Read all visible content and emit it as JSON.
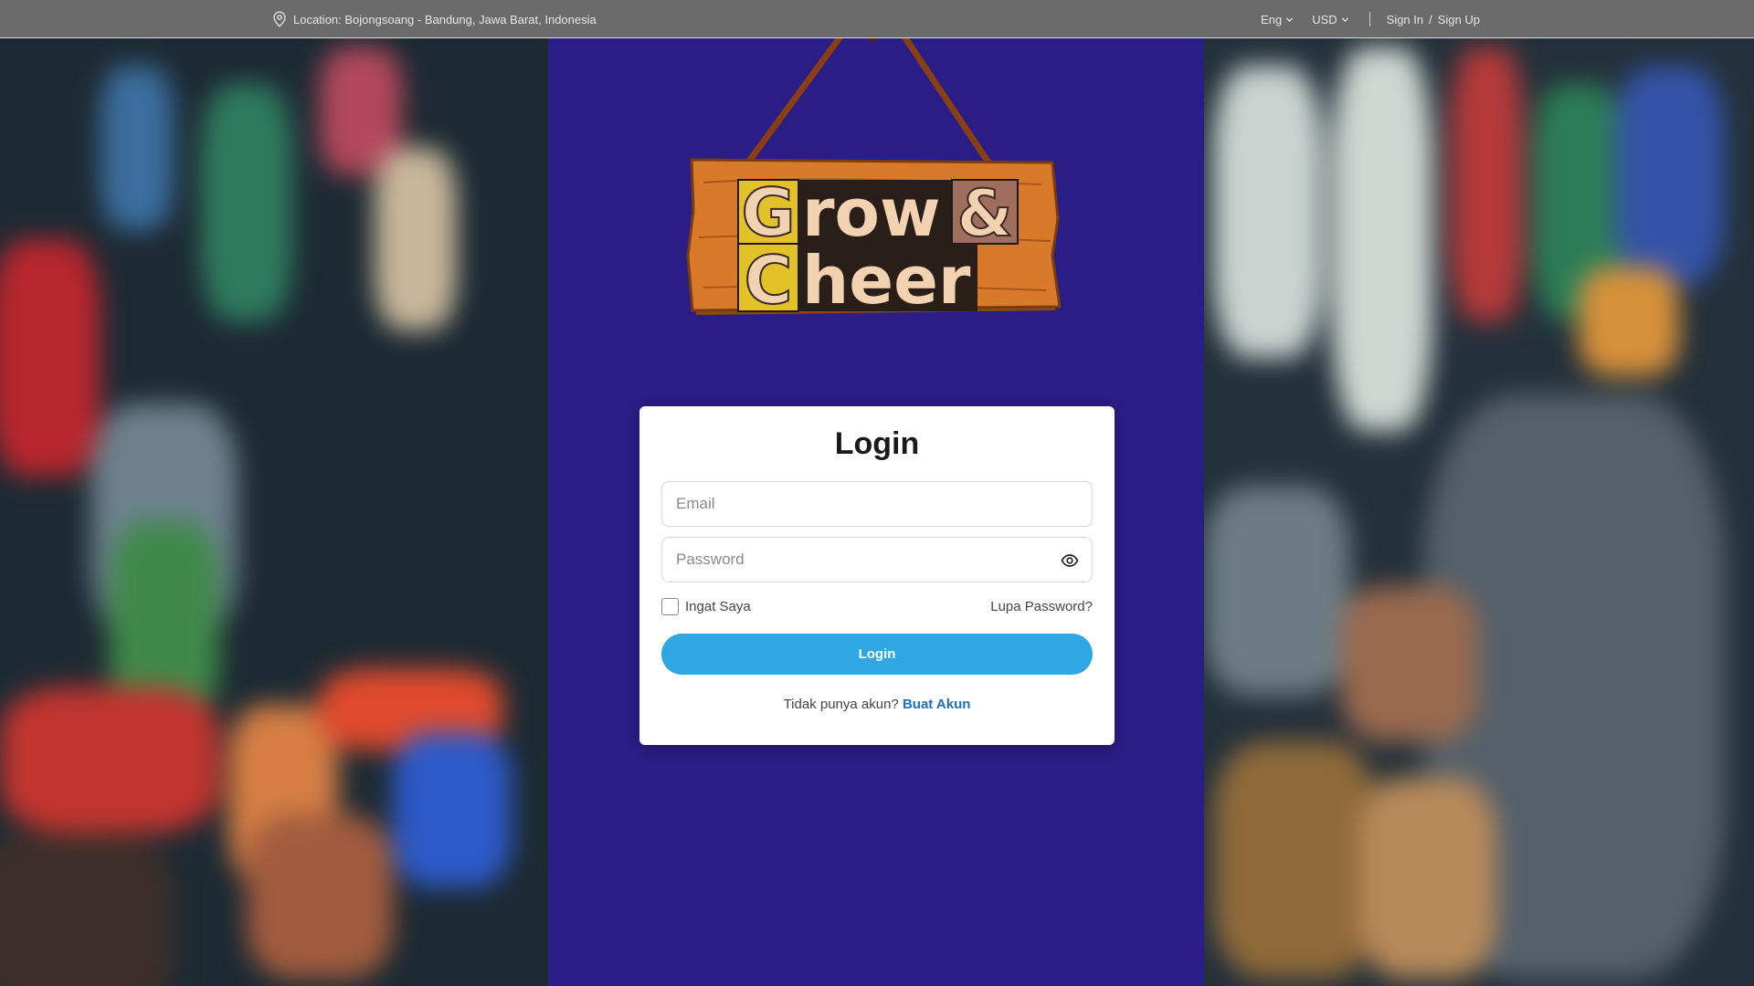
{
  "topbar": {
    "location_icon": "map-pin-icon",
    "location_text": "Location: Bojongsoang - Bandung, Jawa Barat, Indonesia",
    "language": "Eng",
    "currency": "USD",
    "sign_in": "Sign In",
    "separator": "/",
    "sign_up": "Sign Up"
  },
  "logo": {
    "line1_first": "G",
    "line1_rest": "row",
    "ampersand": "&",
    "line2_first": "C",
    "line2_rest": "heer"
  },
  "login": {
    "title": "Login",
    "email_placeholder": "Email",
    "password_placeholder": "Password",
    "remember_label": "Ingat Saya",
    "forgot_label": "Lupa Password?",
    "button_label": "Login",
    "no_account_text": "Tidak punya akun?",
    "create_account_link": "Buat Akun"
  },
  "colors": {
    "topbar_bg": "#6b6b6b",
    "center_bg": "#2a1d86",
    "button_bg": "#2ea7e2",
    "link": "#1b6fc5"
  }
}
